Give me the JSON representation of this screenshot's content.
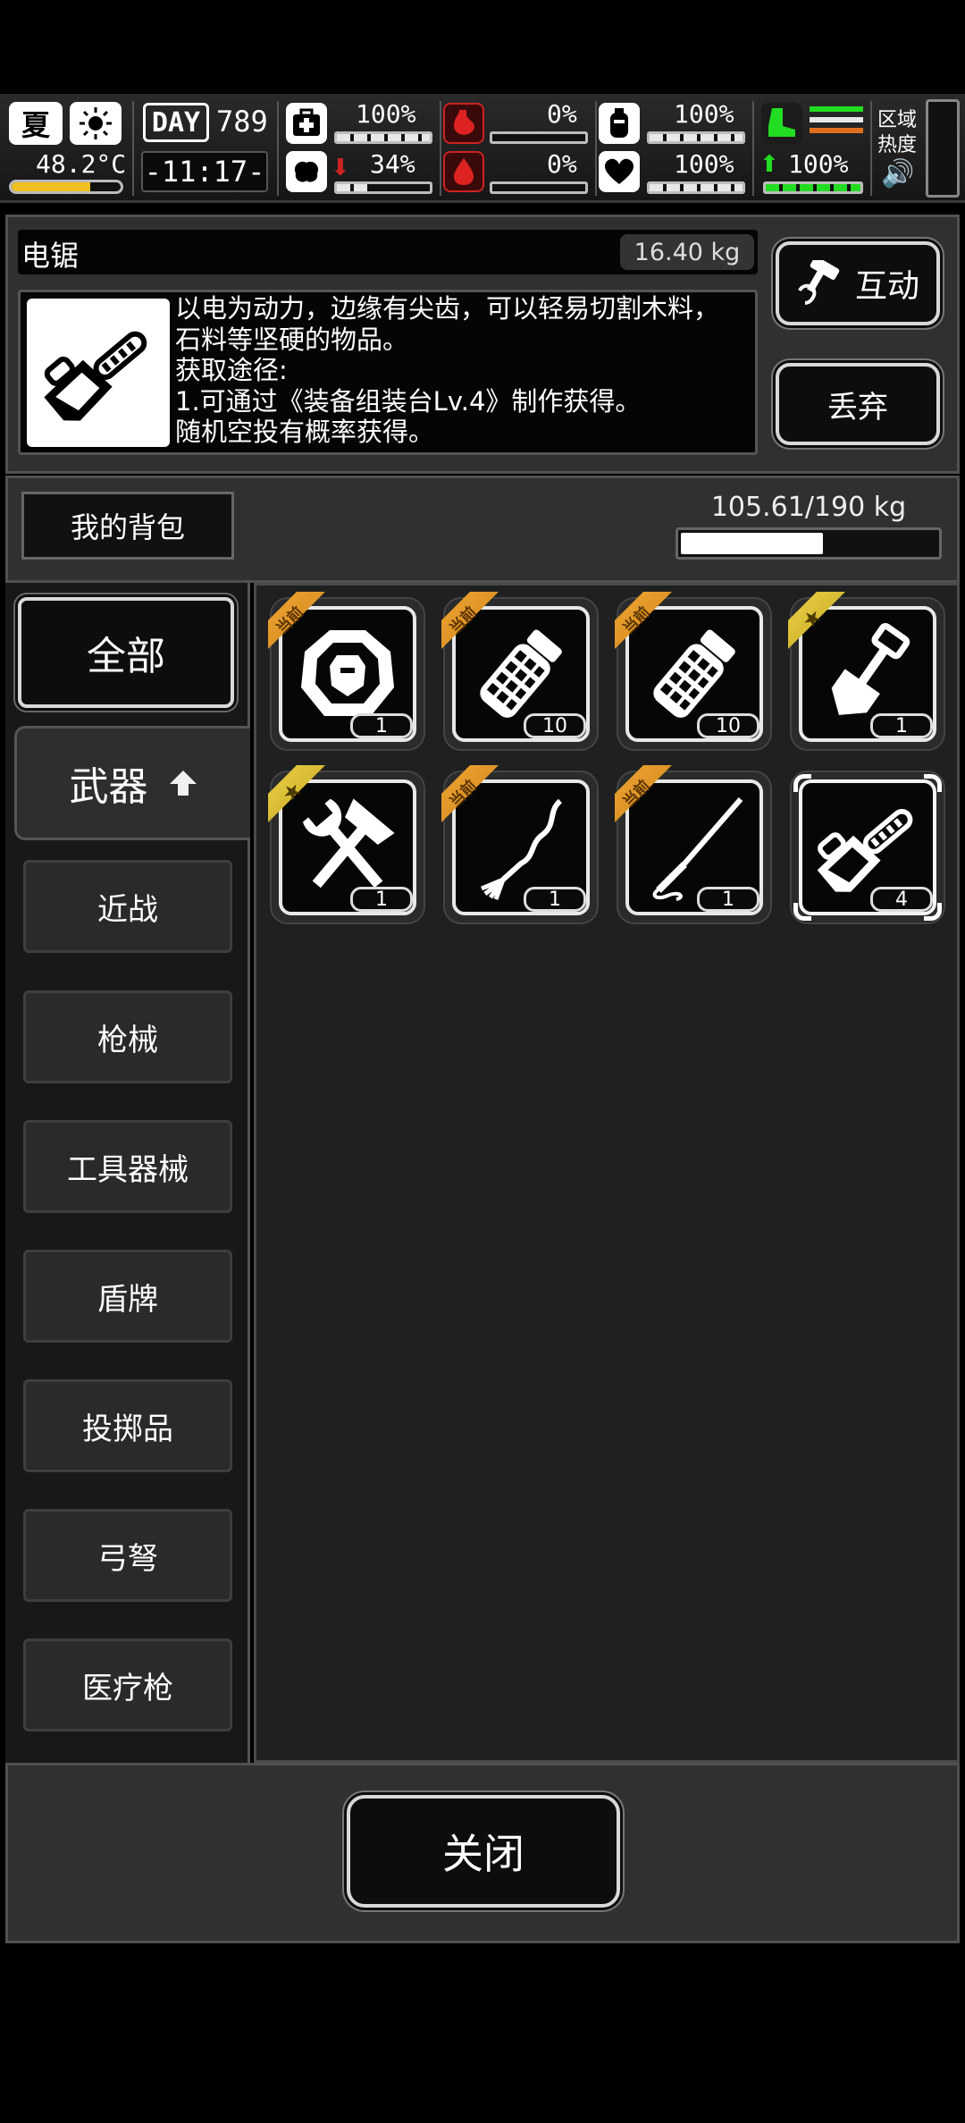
{
  "hud": {
    "season": "夏",
    "temperature": "48.2°C",
    "day_label": "DAY",
    "day_number": "789",
    "clock": "-11:17-",
    "health_pct": "100%",
    "sanity_pct": "34%",
    "hunger_pct": "0%",
    "blood_pct": "0%",
    "water_pct": "100%",
    "heart_pct": "100%",
    "stamina_pct": "100%",
    "zone_label": "区域",
    "heat_label": "热度",
    "values": {
      "health": 1.0,
      "sanity": 0.34,
      "hunger": 0.0,
      "blood": 0.0,
      "water": 1.0,
      "heart": 1.0,
      "stamina": 1.0,
      "temperature_gauge": 0.72
    },
    "colors": {
      "danger": "#cc2222",
      "stamina": "#22dd22",
      "temp_gauge": "#f0c020"
    }
  },
  "item": {
    "name": "电锯",
    "weight": "16.40 kg",
    "description_lines": [
      "以电为动力，边缘有尖齿，可以轻易切割木料，",
      "石料等坚硬的物品。",
      "获取途径:",
      "1.可通过《装备组装台Lv.4》制作获得。",
      "随机空投有概率获得。"
    ],
    "interact_label": "互动",
    "discard_label": "丢弃"
  },
  "bag": {
    "title": "我的背包",
    "capacity": "105.61/190 kg",
    "capacity_fraction": 0.556
  },
  "categories": {
    "all": "全部",
    "weapons": "武器",
    "sub": [
      "近战",
      "枪械",
      "工具器械",
      "盾牌",
      "投掷品",
      "弓弩",
      "医疗枪"
    ]
  },
  "inventory": [
    {
      "icon": "armor-plate-icon",
      "count": "1",
      "tag": "当前"
    },
    {
      "icon": "grenade-icon",
      "count": "10",
      "tag": "当前"
    },
    {
      "icon": "grenade-icon",
      "count": "10",
      "tag": "当前"
    },
    {
      "icon": "shovel-icon",
      "count": "1",
      "tag": "star"
    },
    {
      "icon": "hammer-wrench-icon",
      "count": "1",
      "tag": "star"
    },
    {
      "icon": "whip-icon",
      "count": "1",
      "tag": "当前"
    },
    {
      "icon": "sword-icon",
      "count": "1",
      "tag": "当前"
    },
    {
      "icon": "chainsaw-icon",
      "count": "4",
      "tag": "",
      "selected": true
    }
  ],
  "footer": {
    "close_label": "关闭"
  }
}
